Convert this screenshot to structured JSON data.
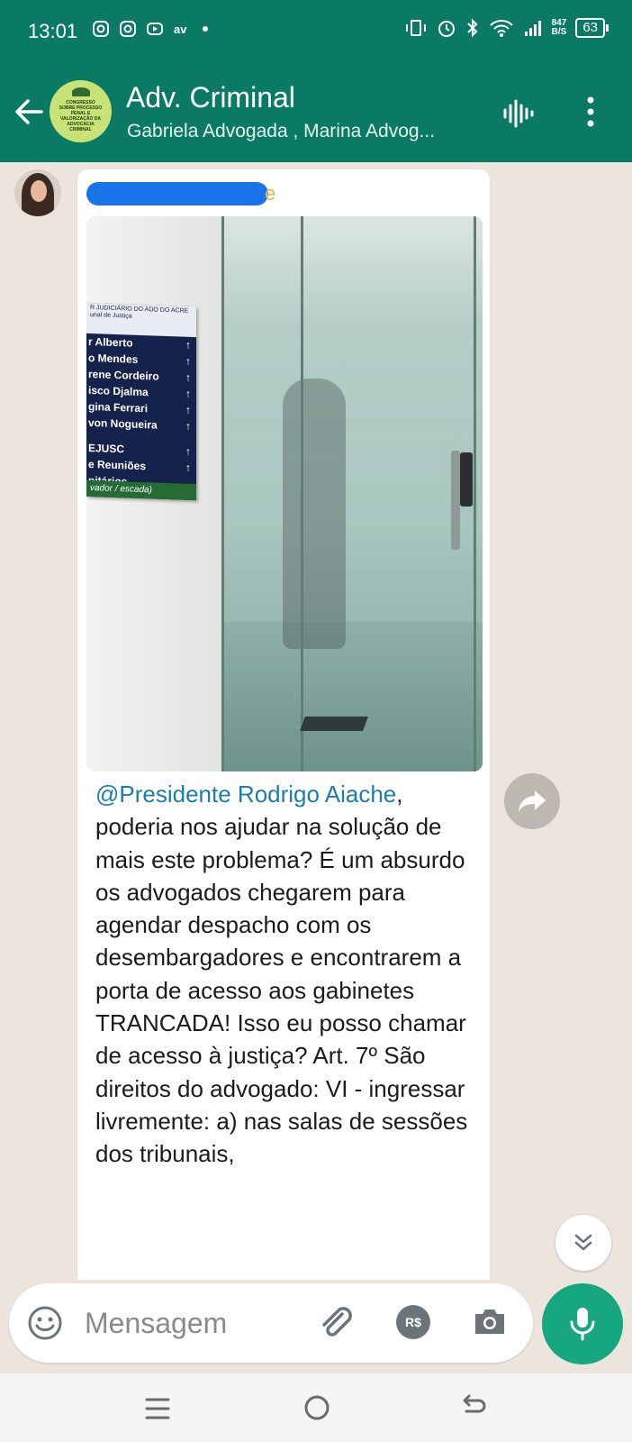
{
  "status_bar": {
    "time": "13:01",
    "net_speed": "847",
    "net_unit": "B/S",
    "battery": "63"
  },
  "header": {
    "title": "Adv. Criminal",
    "subtitle": "Gabriela Advogada , Marina Advog...",
    "avatar_text": "CONGRESSO SOBRE PROCESSO PENAL E VALORIZAÇÃO DA ADVOCACIA CRIMINAL"
  },
  "message": {
    "photo_sign": {
      "header": "R JUDICIÁRIO DO ADO DO ACRE unal de Justiça",
      "rows": [
        "r Alberto",
        "o Mendes",
        "rene Cordeiro",
        "isco Djalma",
        "gina Ferrari",
        "von Nogueira",
        "",
        "EJUSC",
        "e Reuniões",
        "nitários"
      ],
      "footer": "vador / escada)"
    },
    "mention": "@Presidente Rodrigo Aiache",
    "text": ", poderia nos ajudar na solução de mais este problema? É um absurdo os advogados chegarem para agendar despacho com os desembargadores e encontrarem a porta de acesso aos gabinetes TRANCADA! Isso eu posso chamar de acesso à justiça? Art. 7º São direitos do advogado: VI - ingressar livremente: a) nas salas de sessões dos tribunais,"
  },
  "input": {
    "placeholder": "Mensagem",
    "pay_label": "R$"
  },
  "colors": {
    "header_green": "#0b7a64",
    "mic_green": "#16a77e",
    "mention_blue": "#1a7fa8",
    "chat_background": "#ece5dd"
  }
}
